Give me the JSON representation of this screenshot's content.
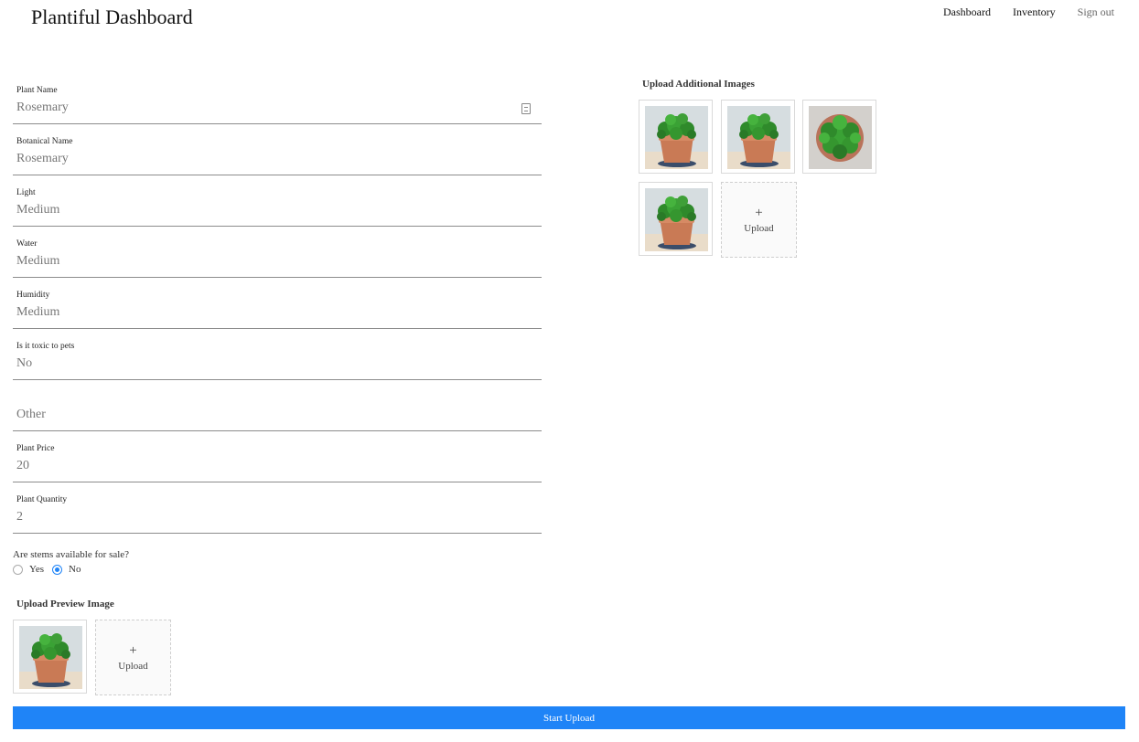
{
  "header": {
    "title": "Plantiful Dashboard",
    "nav": [
      {
        "label": "Dashboard"
      },
      {
        "label": "Inventory"
      },
      {
        "label": "Sign out"
      }
    ]
  },
  "form": {
    "fields": [
      {
        "label": "Plant Name",
        "value": "Rosemary"
      },
      {
        "label": "Botanical Name",
        "value": "Rosemary"
      },
      {
        "label": "Light",
        "value": "Medium"
      },
      {
        "label": "Water",
        "value": "Medium"
      },
      {
        "label": "Humidity",
        "value": "Medium"
      },
      {
        "label": "Is it toxic to pets",
        "value": "No"
      },
      {
        "label": "",
        "value": "Other"
      },
      {
        "label": "Plant Price",
        "value": "20"
      },
      {
        "label": "Plant Quantity",
        "value": "2"
      }
    ],
    "stems": {
      "question": "Are stems available for sale?",
      "options": [
        "Yes",
        "No"
      ],
      "selected": "No"
    }
  },
  "preview": {
    "title": "Upload Preview Image",
    "image": "plant-photo",
    "upload": {
      "plus": "+",
      "label": "Upload"
    }
  },
  "additional": {
    "title": "Upload Additional Images",
    "images": [
      "plant-photo",
      "plant-photo",
      "plant-photo-top",
      "plant-photo"
    ],
    "upload": {
      "plus": "+",
      "label": "Upload"
    }
  },
  "actions": {
    "start_upload": "Start Upload"
  },
  "colors": {
    "primary": "#1f84f7"
  }
}
